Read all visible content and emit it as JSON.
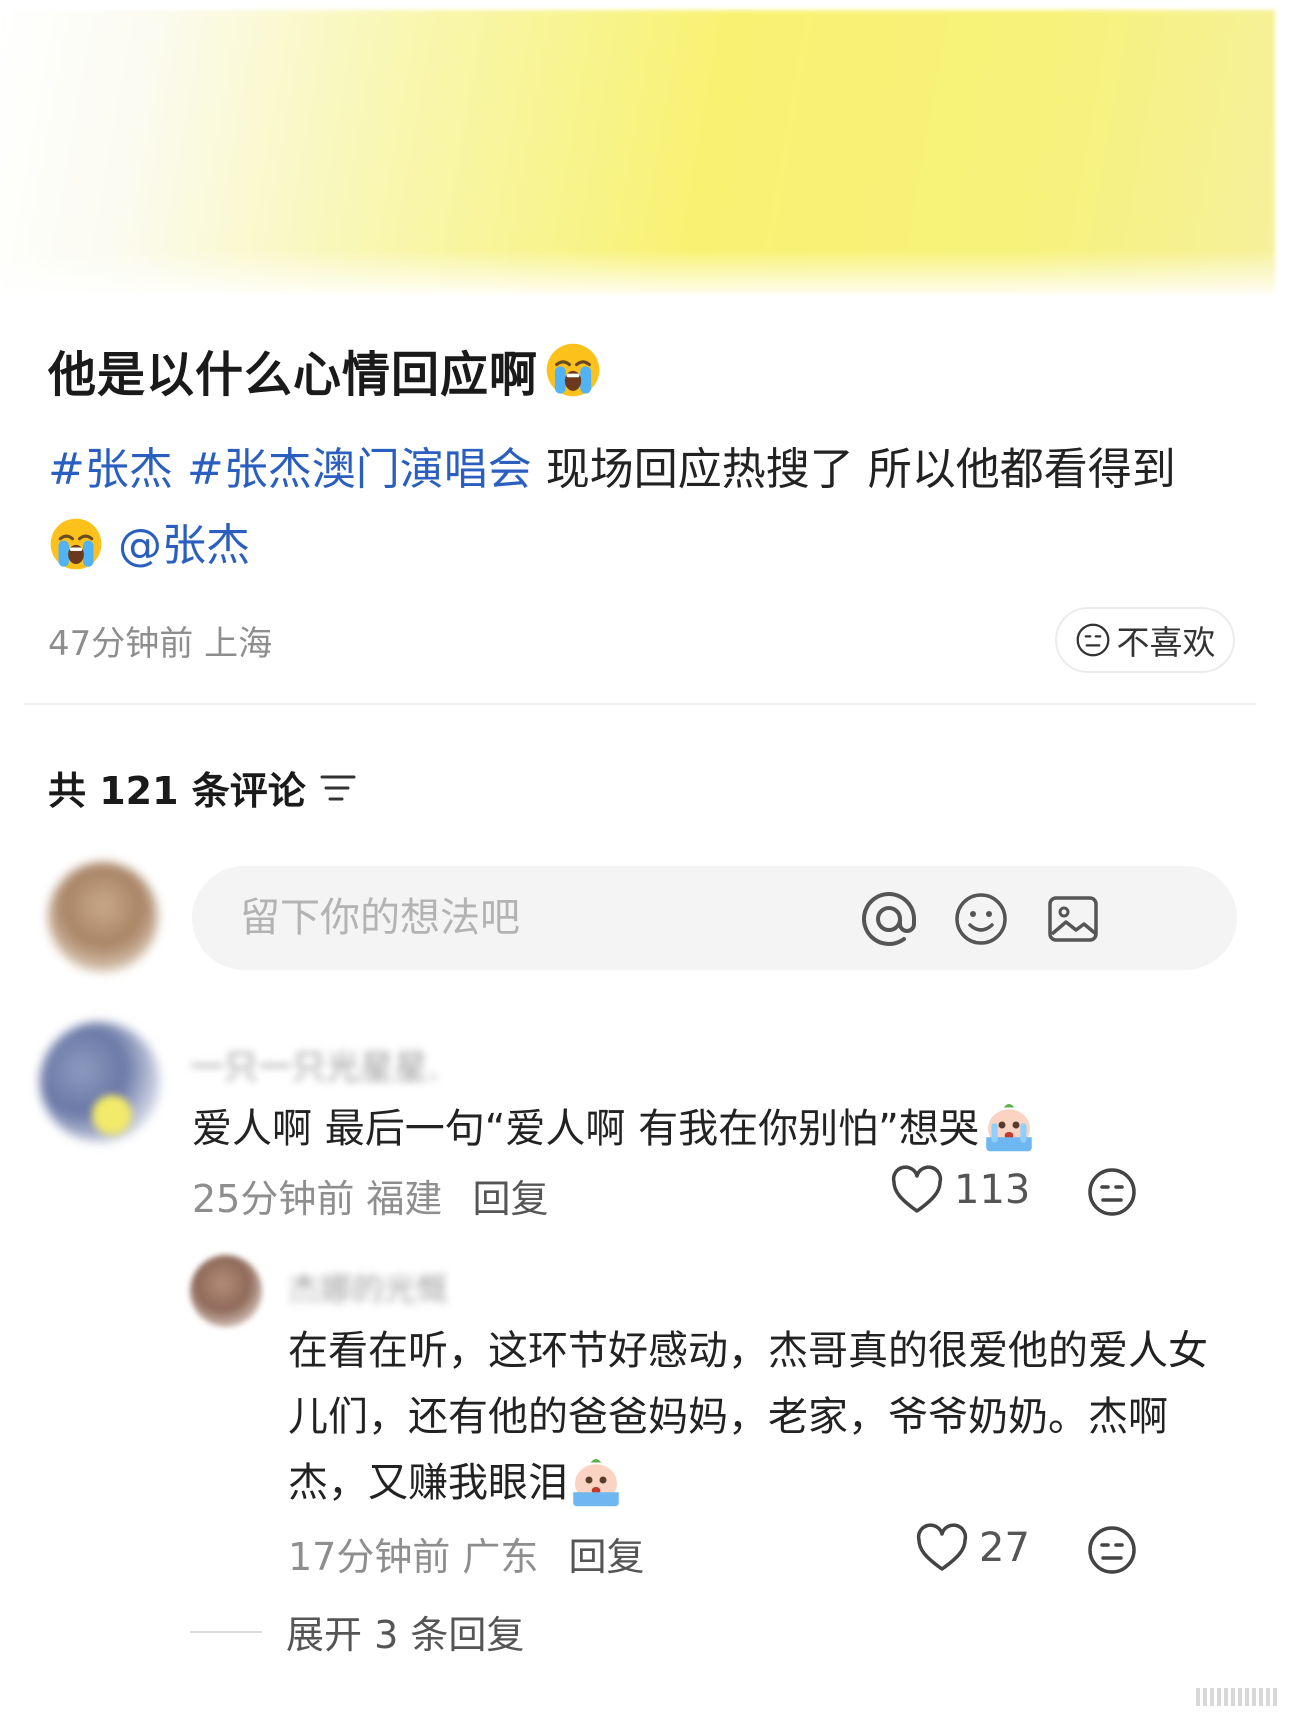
{
  "post": {
    "title": "他是以什么心情回应啊",
    "title_emoji": "loudly-crying-face-icon",
    "body": {
      "tag1": "#张杰",
      "tag2": "#张杰澳门演唱会",
      "text": " 现场回应热搜了 所以他都看得到",
      "mention": "@张杰"
    },
    "meta": "47分钟前 上海",
    "dislike_label": "不喜欢"
  },
  "comments_header": {
    "count_label": "共 121 条评论"
  },
  "comment_input": {
    "placeholder": "留下你的想法吧"
  },
  "comments": [
    {
      "username": "一只一只光星星.",
      "text": "爱人啊 最后一句“爱人啊 有我在你别怕”想哭",
      "meta": "25分钟前 福建",
      "reply_label": "回复",
      "likes": "113",
      "replies": [
        {
          "username": "杰娜的光慨",
          "text": "在看在听，这环节好感动，杰哥真的很爱他的爱人女儿们，还有他的爸爸妈妈，老家，爷爷奶奶。杰啊杰，又赚我眼泪",
          "meta": "17分钟前 广东",
          "reply_label": "回复",
          "likes": "27"
        }
      ],
      "expand_label": "展开 3 条回复"
    }
  ],
  "colors": {
    "link": "#2a5fc0",
    "meta": "#8e8e8e",
    "hero_yellow": "#f8f273"
  }
}
